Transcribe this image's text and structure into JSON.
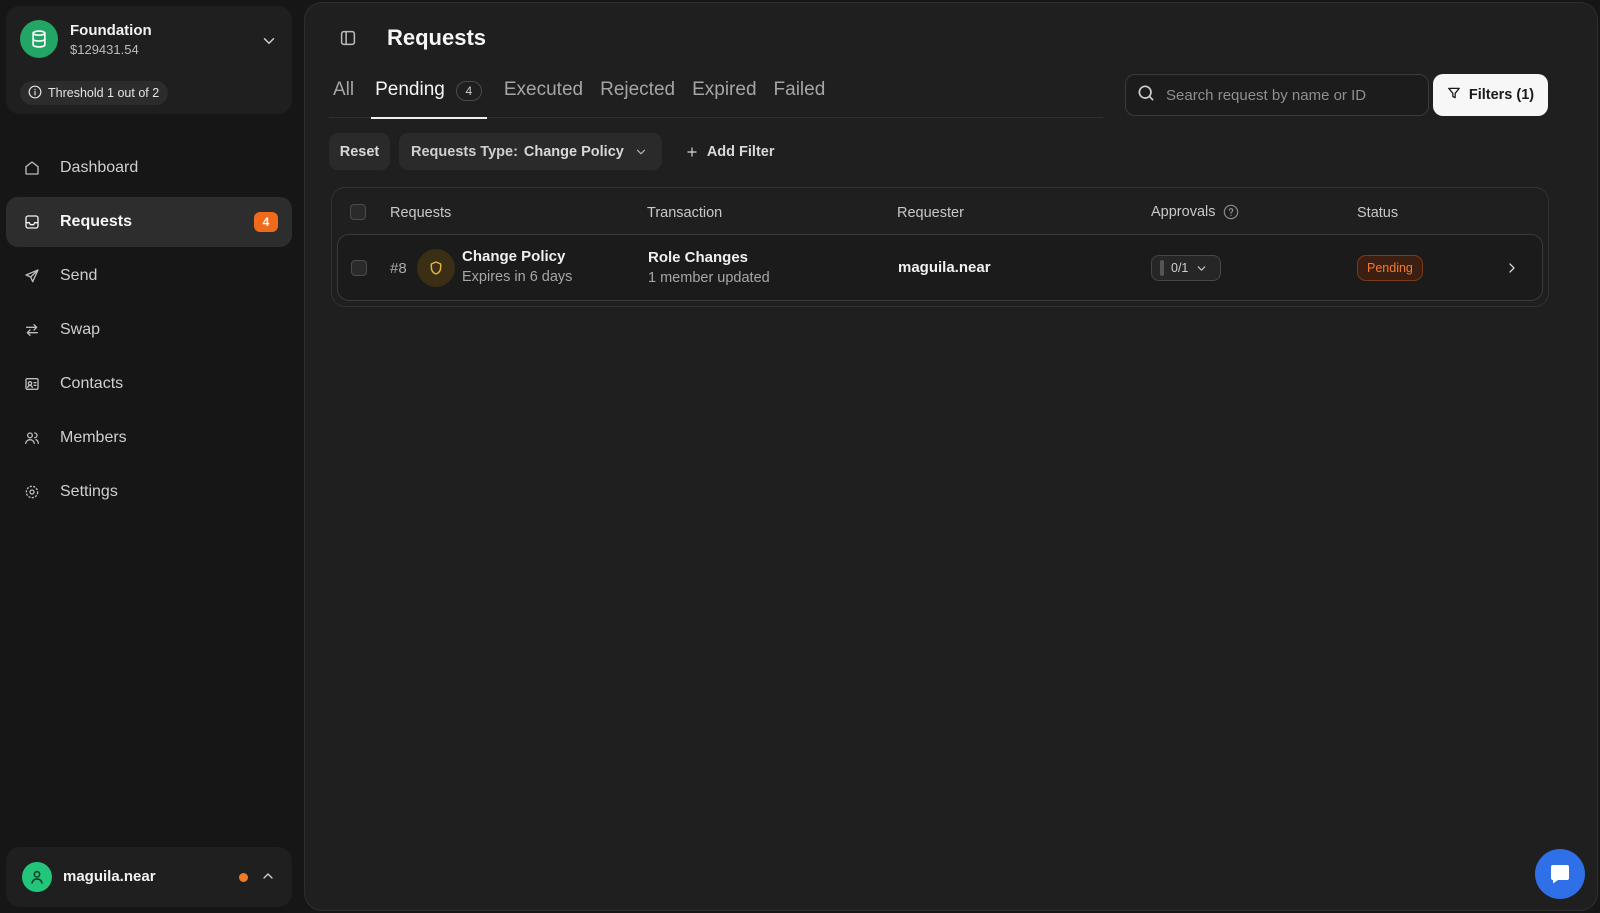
{
  "org": {
    "name": "Foundation",
    "balance": "$129431.54",
    "threshold": "Threshold 1 out of 2"
  },
  "nav": {
    "items": [
      {
        "label": "Dashboard",
        "icon": "home-icon"
      },
      {
        "label": "Requests",
        "icon": "inbox-icon",
        "badge": "4",
        "active": true
      },
      {
        "label": "Send",
        "icon": "send-icon"
      },
      {
        "label": "Swap",
        "icon": "swap-icon"
      },
      {
        "label": "Contacts",
        "icon": "contact-card-icon"
      },
      {
        "label": "Members",
        "icon": "users-icon"
      },
      {
        "label": "Settings",
        "icon": "gear-icon"
      }
    ]
  },
  "user": {
    "name": "maguila.near"
  },
  "page": {
    "title": "Requests"
  },
  "tabs": [
    {
      "label": "All"
    },
    {
      "label": "Pending",
      "count": "4",
      "active": true
    },
    {
      "label": "Executed"
    },
    {
      "label": "Rejected"
    },
    {
      "label": "Expired"
    },
    {
      "label": "Failed"
    }
  ],
  "search": {
    "placeholder": "Search request by name or ID",
    "value": ""
  },
  "filters_button": {
    "label": "Filters (1)"
  },
  "filter_bar": {
    "reset_label": "Reset",
    "type_label": "Requests Type:",
    "type_value": "Change Policy",
    "add_filter_label": "Add Filter"
  },
  "table": {
    "columns": [
      "Requests",
      "Transaction",
      "Requester",
      "Approvals",
      "Status"
    ],
    "rows": [
      {
        "id": "#8",
        "title": "Change Policy",
        "expires": "Expires in 6 days",
        "transaction_title": "Role Changes",
        "transaction_sub": "1 member updated",
        "requester": "maguila.near",
        "approvals": "0/1",
        "status": "Pending"
      }
    ]
  },
  "colors": {
    "accent_orange": "#ef6b1b",
    "brand_green": "#22a565",
    "chat_blue": "#2f6fe8"
  }
}
